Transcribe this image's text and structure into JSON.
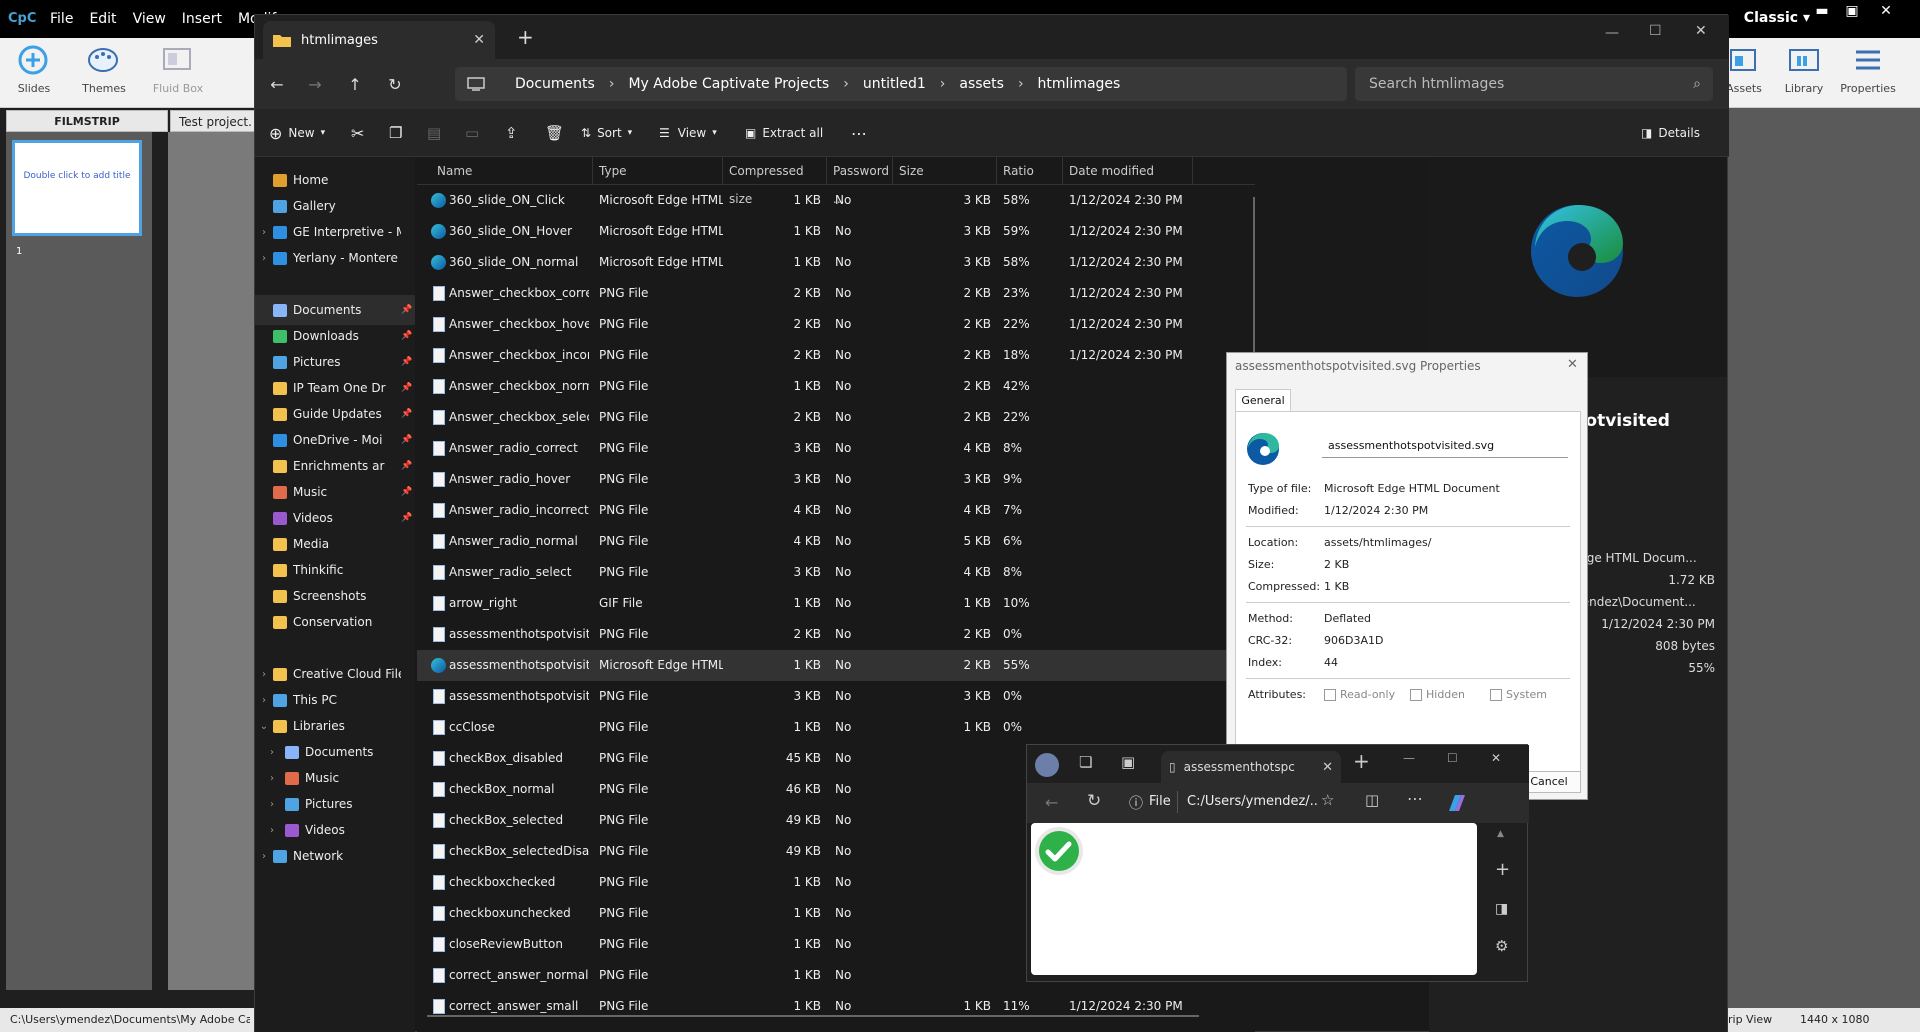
{
  "captivate": {
    "logo": "CpC",
    "menu": [
      "File",
      "Edit",
      "View",
      "Insert",
      "Modify"
    ],
    "mode": "Classic",
    "ribbon_left": [
      {
        "label": "Slides",
        "icon": "add-slide-icon"
      },
      {
        "label": "Themes",
        "icon": "palette-icon"
      },
      {
        "label": "Fluid Box",
        "icon": "fluid-box-icon"
      }
    ],
    "ribbon_right": [
      {
        "label": "Assets",
        "icon": "assets-icon"
      },
      {
        "label": "Library",
        "icon": "library-icon"
      },
      {
        "label": "Properties",
        "icon": "properties-icon"
      }
    ],
    "filmstrip_label": "FILMSTRIP",
    "slide_placeholder": "Double click to add title",
    "slide_number": "1",
    "doc_tab": "Test project.",
    "status_path": "C:\\Users\\ymendez\\Documents\\My Adobe Captiva",
    "status_view": "rip View",
    "status_resolution": "1440 x 1080"
  },
  "explorer": {
    "tab_title": "htmlimages",
    "breadcrumb": [
      "Documents",
      "My Adobe Captivate Projects",
      "untitled1",
      "assets",
      "htmlimages"
    ],
    "search_placeholder": "Search htmlimages",
    "toolbar": {
      "new": "New",
      "sort": "Sort",
      "view": "View",
      "extract": "Extract all",
      "details": "Details"
    },
    "nav": [
      {
        "label": "Home",
        "icon": "home-icon",
        "color": "#e0a030"
      },
      {
        "label": "Gallery",
        "icon": "gallery-icon",
        "color": "#4fa3e3"
      },
      {
        "label": "GE Interpretive - M",
        "icon": "cloud-icon",
        "color": "#2f8fe0",
        "chevron": true
      },
      {
        "label": "Yerlany - Montere",
        "icon": "cloud-icon",
        "color": "#2f8fe0",
        "chevron": true
      },
      {
        "label": "Documents",
        "icon": "documents-icon",
        "color": "#8ab4f8",
        "pinned": true,
        "selected": true
      },
      {
        "label": "Downloads",
        "icon": "download-icon",
        "color": "#3ec06b",
        "pinned": true
      },
      {
        "label": "Pictures",
        "icon": "pictures-icon",
        "color": "#4fa3e3",
        "pinned": true
      },
      {
        "label": "IP Team One Dr",
        "icon": "folder-icon",
        "color": "#f2c14e",
        "pinned": true
      },
      {
        "label": "Guide Updates",
        "icon": "folder-icon",
        "color": "#f2c14e",
        "pinned": true
      },
      {
        "label": "OneDrive - Moi",
        "icon": "cloud-icon",
        "color": "#2f8fe0",
        "pinned": true
      },
      {
        "label": "Enrichments ar",
        "icon": "folder-icon",
        "color": "#f2c14e",
        "pinned": true
      },
      {
        "label": "Music",
        "icon": "music-icon",
        "color": "#e06b4a",
        "pinned": true
      },
      {
        "label": "Videos",
        "icon": "videos-icon",
        "color": "#9b59d0",
        "pinned": true
      },
      {
        "label": "Media",
        "icon": "folder-icon",
        "color": "#f2c14e"
      },
      {
        "label": "Thinkific",
        "icon": "folder-icon",
        "color": "#f2c14e"
      },
      {
        "label": "Screenshots",
        "icon": "folder-icon",
        "color": "#f2c14e"
      },
      {
        "label": "Conservation",
        "icon": "folder-icon",
        "color": "#f2c14e"
      },
      {
        "label": "Creative Cloud File",
        "icon": "folder-icon",
        "color": "#f2c14e",
        "chevron": true
      },
      {
        "label": "This PC",
        "icon": "pc-icon",
        "color": "#4fa3e3",
        "chevron": true
      },
      {
        "label": "Libraries",
        "icon": "folder-icon",
        "color": "#f2c14e",
        "chevron": true,
        "expanded": true
      },
      {
        "label": "Documents",
        "icon": "documents-icon",
        "color": "#8ab4f8",
        "chevron": true,
        "indent": true
      },
      {
        "label": "Music",
        "icon": "music-icon",
        "color": "#e06b4a",
        "chevron": true,
        "indent": true
      },
      {
        "label": "Pictures",
        "icon": "pictures-icon",
        "color": "#4fa3e3",
        "chevron": true,
        "indent": true
      },
      {
        "label": "Videos",
        "icon": "videos-icon",
        "color": "#9b59d0",
        "chevron": true,
        "indent": true
      },
      {
        "label": "Network",
        "icon": "network-icon",
        "color": "#4fa3e3",
        "chevron": true
      }
    ],
    "columns": [
      "Name",
      "Type",
      "Compressed size",
      "Password ...",
      "Size",
      "Ratio",
      "Date modified"
    ],
    "files": [
      {
        "name": "360_slide_ON_Click",
        "type": "Microsoft Edge HTML Do...",
        "comp": "1 KB",
        "pw": "No",
        "size": "3 KB",
        "ratio": "58%",
        "date": "1/12/2024 2:30 PM",
        "icon": "edge"
      },
      {
        "name": "360_slide_ON_Hover",
        "type": "Microsoft Edge HTML Do...",
        "comp": "1 KB",
        "pw": "No",
        "size": "3 KB",
        "ratio": "59%",
        "date": "1/12/2024 2:30 PM",
        "icon": "edge"
      },
      {
        "name": "360_slide_ON_normal",
        "type": "Microsoft Edge HTML Do...",
        "comp": "1 KB",
        "pw": "No",
        "size": "3 KB",
        "ratio": "58%",
        "date": "1/12/2024 2:30 PM",
        "icon": "edge"
      },
      {
        "name": "Answer_checkbox_correct",
        "type": "PNG File",
        "comp": "2 KB",
        "pw": "No",
        "size": "2 KB",
        "ratio": "23%",
        "date": "1/12/2024 2:30 PM",
        "icon": "png"
      },
      {
        "name": "Answer_checkbox_hover",
        "type": "PNG File",
        "comp": "2 KB",
        "pw": "No",
        "size": "2 KB",
        "ratio": "22%",
        "date": "1/12/2024 2:30 PM",
        "icon": "png"
      },
      {
        "name": "Answer_checkbox_incorrect",
        "type": "PNG File",
        "comp": "2 KB",
        "pw": "No",
        "size": "2 KB",
        "ratio": "18%",
        "date": "1/12/2024 2:30 PM",
        "icon": "png"
      },
      {
        "name": "Answer_checkbox_normal",
        "type": "PNG File",
        "comp": "1 KB",
        "pw": "No",
        "size": "2 KB",
        "ratio": "42%",
        "date": "",
        "icon": "png"
      },
      {
        "name": "Answer_checkbox_select",
        "type": "PNG File",
        "comp": "2 KB",
        "pw": "No",
        "size": "2 KB",
        "ratio": "22%",
        "date": "",
        "icon": "png"
      },
      {
        "name": "Answer_radio_correct",
        "type": "PNG File",
        "comp": "3 KB",
        "pw": "No",
        "size": "4 KB",
        "ratio": "8%",
        "date": "",
        "icon": "png"
      },
      {
        "name": "Answer_radio_hover",
        "type": "PNG File",
        "comp": "3 KB",
        "pw": "No",
        "size": "3 KB",
        "ratio": "9%",
        "date": "",
        "icon": "png"
      },
      {
        "name": "Answer_radio_incorrect",
        "type": "PNG File",
        "comp": "4 KB",
        "pw": "No",
        "size": "4 KB",
        "ratio": "7%",
        "date": "",
        "icon": "png"
      },
      {
        "name": "Answer_radio_normal",
        "type": "PNG File",
        "comp": "4 KB",
        "pw": "No",
        "size": "5 KB",
        "ratio": "6%",
        "date": "",
        "icon": "png"
      },
      {
        "name": "Answer_radio_select",
        "type": "PNG File",
        "comp": "3 KB",
        "pw": "No",
        "size": "4 KB",
        "ratio": "8%",
        "date": "",
        "icon": "png"
      },
      {
        "name": "arrow_right",
        "type": "GIF File",
        "comp": "1 KB",
        "pw": "No",
        "size": "1 KB",
        "ratio": "10%",
        "date": "",
        "icon": "png"
      },
      {
        "name": "assessmenthotspotvisited",
        "type": "PNG File",
        "comp": "2 KB",
        "pw": "No",
        "size": "2 KB",
        "ratio": "0%",
        "date": "",
        "icon": "png"
      },
      {
        "name": "assessmenthotspotvisited",
        "type": "Microsoft Edge HTML Do...",
        "comp": "1 KB",
        "pw": "No",
        "size": "2 KB",
        "ratio": "55%",
        "date": "",
        "icon": "edge",
        "selected": true
      },
      {
        "name": "assessmenthotspotvisited@2x",
        "type": "PNG File",
        "comp": "3 KB",
        "pw": "No",
        "size": "3 KB",
        "ratio": "0%",
        "date": "",
        "icon": "png"
      },
      {
        "name": "ccClose",
        "type": "PNG File",
        "comp": "1 KB",
        "pw": "No",
        "size": "1 KB",
        "ratio": "0%",
        "date": "",
        "icon": "png"
      },
      {
        "name": "checkBox_disabled",
        "type": "PNG File",
        "comp": "45 KB",
        "pw": "No",
        "size": "",
        "ratio": "",
        "date": "",
        "icon": "png"
      },
      {
        "name": "checkBox_normal",
        "type": "PNG File",
        "comp": "46 KB",
        "pw": "No",
        "size": "",
        "ratio": "",
        "date": "",
        "icon": "png"
      },
      {
        "name": "checkBox_selected",
        "type": "PNG File",
        "comp": "49 KB",
        "pw": "No",
        "size": "",
        "ratio": "",
        "date": "",
        "icon": "png"
      },
      {
        "name": "checkBox_selectedDisabled",
        "type": "PNG File",
        "comp": "49 KB",
        "pw": "No",
        "size": "",
        "ratio": "",
        "date": "",
        "icon": "png"
      },
      {
        "name": "checkboxchecked",
        "type": "PNG File",
        "comp": "1 KB",
        "pw": "No",
        "size": "",
        "ratio": "",
        "date": "",
        "icon": "png"
      },
      {
        "name": "checkboxunchecked",
        "type": "PNG File",
        "comp": "1 KB",
        "pw": "No",
        "size": "",
        "ratio": "",
        "date": "",
        "icon": "png"
      },
      {
        "name": "closeReviewButton",
        "type": "PNG File",
        "comp": "1 KB",
        "pw": "No",
        "size": "",
        "ratio": "",
        "date": "",
        "icon": "png"
      },
      {
        "name": "correct_answer_normal",
        "type": "PNG File",
        "comp": "1 KB",
        "pw": "No",
        "size": "",
        "ratio": "",
        "date": "",
        "icon": "png"
      },
      {
        "name": "correct_answer_small",
        "type": "PNG File",
        "comp": "1 KB",
        "pw": "No",
        "size": "1 KB",
        "ratio": "11%",
        "date": "1/12/2024 2:30 PM",
        "icon": "png"
      }
    ],
    "details_pane": {
      "title_frag": "tspotvisited",
      "type_frag": "t Edge HTML Docum...",
      "size": "1.72 KB",
      "path_frag": "ymendez\\Document...",
      "date": "1/12/2024 2:30 PM",
      "bytes": "808 bytes",
      "ratio": "55%"
    }
  },
  "properties": {
    "title": "assessmenthotspotvisited.svg Properties",
    "tab": "General",
    "filename": "assessmenthotspotvisited.svg",
    "type_label": "Type of file:",
    "type_value": "Microsoft Edge HTML Document",
    "modified_label": "Modified:",
    "modified_value": "1/12/2024 2:30 PM",
    "location_label": "Location:",
    "location_value": "assets/htmlimages/",
    "size_label": "Size:",
    "size_value": "2 KB",
    "compressed_label": "Compressed:",
    "compressed_value": "1 KB",
    "method_label": "Method:",
    "method_value": "Deflated",
    "crc_label": "CRC-32:",
    "crc_value": "906D3A1D",
    "index_label": "Index:",
    "index_value": "44",
    "attributes_label": "Attributes:",
    "attr_readonly": "Read-only",
    "attr_hidden": "Hidden",
    "attr_system": "System",
    "cancel": "Cancel"
  },
  "edge": {
    "tab_title": "assessmenthotspc",
    "site_label": "File",
    "url": "C:/Users/ymendez/..."
  }
}
